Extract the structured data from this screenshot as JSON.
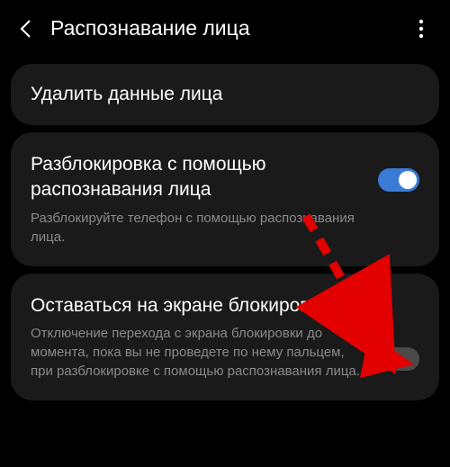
{
  "header": {
    "title": "Распознавание лица"
  },
  "cards": {
    "delete": {
      "label": "Удалить данные лица"
    },
    "unlock": {
      "title": "Разблокировка с помощью распознавания лица",
      "desc": "Разблокируйте телефон с помощью распознавания лица."
    },
    "stay": {
      "title": "Оставаться на экране блокировки",
      "desc": "Отключение перехода с экрана блокировки до момента, пока вы не проведете по нему пальцем, при разблокировке с помощью распознавания лица."
    }
  },
  "toggles": {
    "unlock": true,
    "stay": false
  },
  "annotation": {
    "color": "#e30000"
  }
}
